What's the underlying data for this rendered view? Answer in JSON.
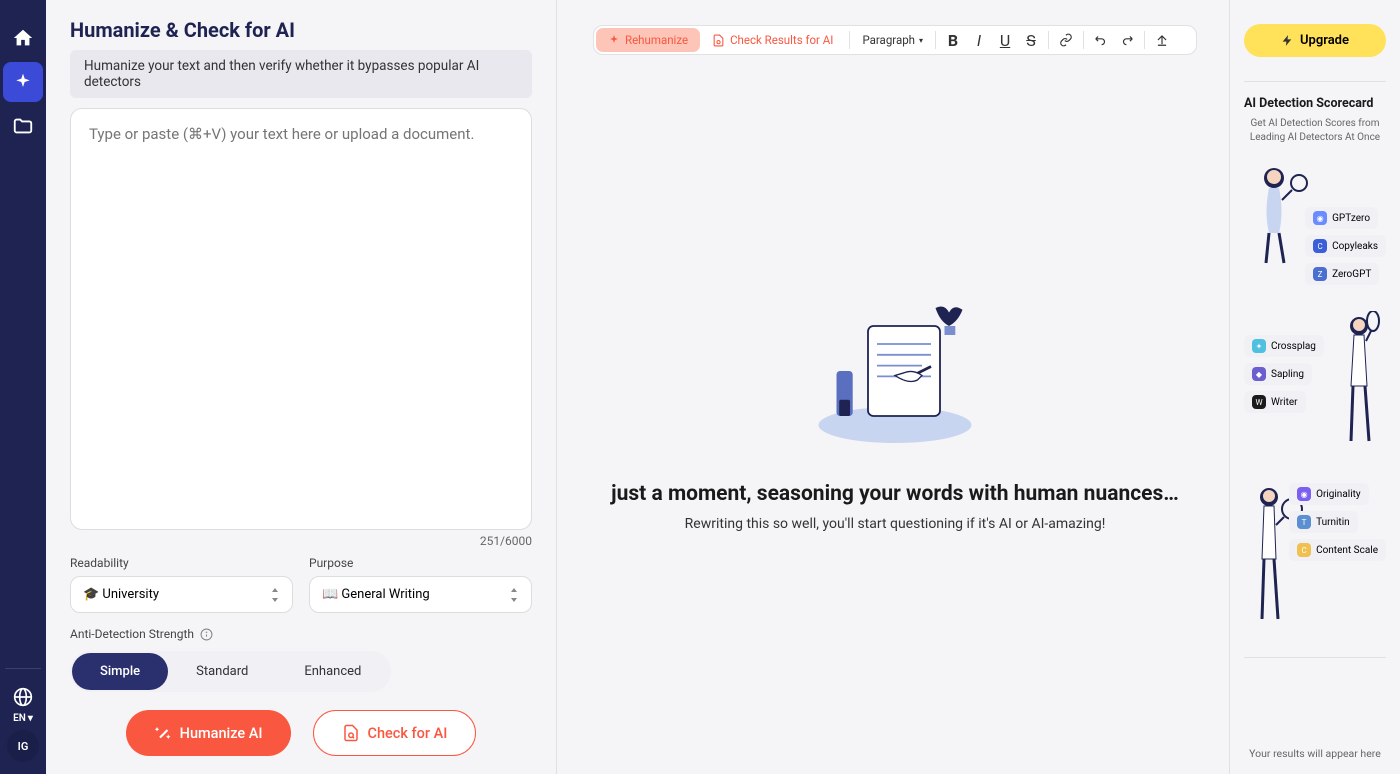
{
  "sidebar": {
    "lang": "EN",
    "avatar": "IG"
  },
  "left": {
    "title": "Humanize & Check for AI",
    "subtitle": "Humanize your text and then verify whether it bypasses popular AI detectors",
    "placeholder": "Type or paste (⌘+V) your text here or upload a document.",
    "counter": "251/6000",
    "readability_label": "Readability",
    "readability_value": "🎓 University",
    "purpose_label": "Purpose",
    "purpose_value": "📖 General Writing",
    "strength_label": "Anti-Detection Strength",
    "strength_options": [
      "Simple",
      "Standard",
      "Enhanced"
    ],
    "humanize_btn": "Humanize AI",
    "check_btn": "Check for AI"
  },
  "toolbar": {
    "rehumanize": "Rehumanize",
    "check_results": "Check Results for AI",
    "paragraph": "Paragraph"
  },
  "loading": {
    "title": "just a moment, seasoning your words with human nuances…",
    "sub": "Rewriting this so well, you'll start questioning if it's AI or AI-amazing!"
  },
  "scorecard": {
    "upgrade": "Upgrade",
    "title": "AI Detection Scorecard",
    "sub": "Get AI Detection Scores from Leading AI Detectors At Once",
    "g1": [
      "GPTzero",
      "Copyleaks",
      "ZeroGPT"
    ],
    "g2": [
      "Crossplag",
      "Sapling",
      "Writer"
    ],
    "g3": [
      "Originality",
      "Turnitin",
      "Content Scale"
    ],
    "results": "Your results will appear here"
  }
}
